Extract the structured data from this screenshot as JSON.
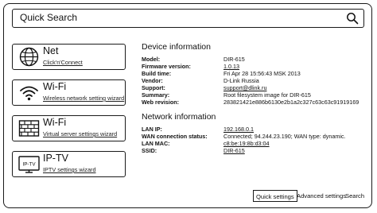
{
  "search": {
    "label": "Quick Search"
  },
  "cards": [
    {
      "title": "Net",
      "subtitle": "Click'n'Connect",
      "icon": "globe-icon"
    },
    {
      "title": "Wi-Fi",
      "subtitle": "Wireless network setting wizard",
      "icon": "wifi-icon"
    },
    {
      "title": "Wi-Fi",
      "subtitle": "Virtual server settings wizard",
      "icon": "firewall-icon"
    },
    {
      "title": "IP-TV",
      "subtitle": "IPTV settings wizard",
      "icon": "tv-icon",
      "icon_text": "IP-TV"
    }
  ],
  "device": {
    "heading": "Device information",
    "rows": [
      {
        "key": "Model:",
        "value": "DIR-615"
      },
      {
        "key": "Firmware version:",
        "value": "1.0.13"
      },
      {
        "key": "Build time:",
        "value": "Fri Apr 28 15:56:43 MSK 2013"
      },
      {
        "key": "Vendor:",
        "value": "D-Link Russia"
      },
      {
        "key": "Support:",
        "value": "support@dlink.ru"
      },
      {
        "key": "Summary:",
        "value": "Root filesystem image for DIR-615"
      },
      {
        "key": "Web revision:",
        "value": "283821421e886b6130e2b1a2c327c63c63c91919169"
      }
    ]
  },
  "network": {
    "heading": "Network information",
    "rows": [
      {
        "key": "LAN IP:",
        "value": "192.168.0.1"
      },
      {
        "key": "WAN connection status:",
        "value": "Connected; 94.244.23.190; WAN type: dynamic."
      },
      {
        "key": "LAN MAC:",
        "value": "c8:be:19:8b:d3:04"
      },
      {
        "key": "SSID:",
        "value": "DIR-615"
      }
    ]
  },
  "footer": {
    "quick_settings": "Quick settings",
    "advanced_settings": "Advanced settings",
    "search": "Search"
  }
}
